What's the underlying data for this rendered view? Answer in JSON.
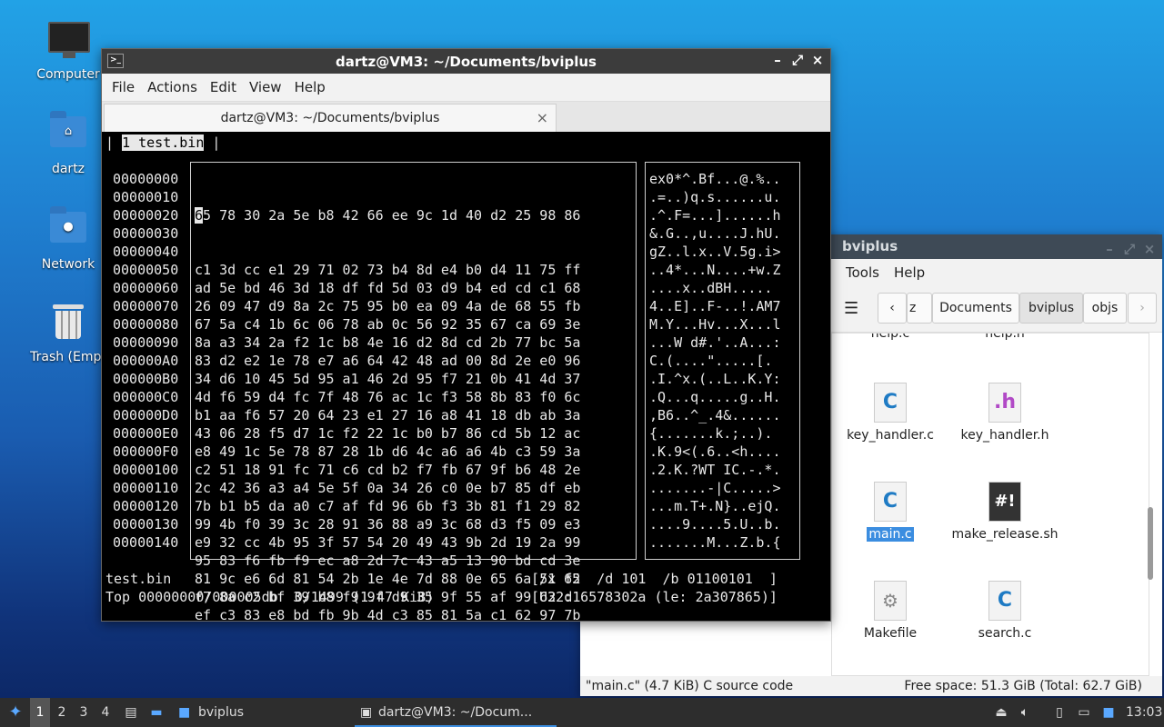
{
  "desktop": {
    "icons": [
      {
        "label": "Computer",
        "icon": "computer-icon"
      },
      {
        "label": "dartz",
        "icon": "home-folder-icon"
      },
      {
        "label": "Network",
        "icon": "network-folder-icon"
      },
      {
        "label": "Trash (Empt",
        "icon": "trash-icon"
      }
    ]
  },
  "terminal": {
    "title": "dartz@VM3: ~/Documents/bviplus",
    "menu": [
      "File",
      "Actions",
      "Edit",
      "View",
      "Help"
    ],
    "tab_label": "dartz@VM3: ~/Documents/bviplus",
    "buffer_tab": "1 test.bin",
    "cursor_char": "6",
    "offsets": [
      "00000000",
      "00000010",
      "00000020",
      "00000030",
      "00000040",
      "00000050",
      "00000060",
      "00000070",
      "00000080",
      "00000090",
      "000000A0",
      "000000B0",
      "000000C0",
      "000000D0",
      "000000E0",
      "000000F0",
      "00000100",
      "00000110",
      "00000120",
      "00000130",
      "00000140"
    ],
    "hex_first_tail": "5 78 30 2a 5e b8 42 66 ee 9c 1d 40 d2 25 98 86",
    "hex_rows": [
      "c1 3d cc e1 29 71 02 73 b4 8d e4 b0 d4 11 75 ff",
      "ad 5e bd 46 3d 18 df fd 5d 03 d9 b4 ed cd c1 68",
      "26 09 47 d9 8a 2c 75 95 b0 ea 09 4a de 68 55 fb",
      "67 5a c4 1b 6c 06 78 ab 0c 56 92 35 67 ca 69 3e",
      "8a a3 34 2a f2 1c b8 4e 16 d2 8d cd 2b 77 bc 5a",
      "83 d2 e2 1e 78 e7 a6 64 42 48 ad 00 8d 2e e0 96",
      "34 d6 10 45 5d 95 a1 46 2d 95 f7 21 0b 41 4d 37",
      "4d f6 59 d4 fc 7f 48 76 ac 1c f3 58 8b 83 f0 6c",
      "b1 aa f6 57 20 64 23 e1 27 16 a8 41 18 db ab 3a",
      "43 06 28 f5 d7 1c f2 22 1c b0 b7 86 cd 5b 12 ac",
      "e8 49 1c 5e 78 87 28 1b d6 4c a6 a6 4b c3 59 3a",
      "c2 51 18 91 fc 71 c6 cd b2 f7 fb 67 9f b6 48 2e",
      "2c 42 36 a3 a4 5e 5f 0a 34 26 c0 0e b7 85 df eb",
      "7b b1 b5 da a0 c7 af fd 96 6b f3 3b 81 f1 29 82",
      "99 4b f0 39 3c 28 91 36 88 a9 3c 68 d3 f5 09 e3",
      "e9 32 cc 4b 95 3f 57 54 20 49 43 9b 2d 19 2a 99",
      "95 83 f6 fb f9 ec a8 2d 7c 43 a5 13 90 bd cd 3e",
      "81 9c e6 6d 81 54 2b 1e 4e 7d 88 0e 65 6a 51 f2",
      "f7 8a c2 bf 39 b8 f9 9f d9 35 9f 55 af 99 62 d1",
      "ef c3 83 e8 bd fb 9b 4d c3 85 81 5a c1 62 97 7b"
    ],
    "ascii_rows": [
      "ex0*^.Bf...@.%..",
      ".=..)q.s......u.",
      ".^.F=...]......h",
      "&.G..,u....J.hU.",
      "gZ..l.x..V.5g.i>",
      "..4*...N....+w.Z",
      "....x..dBH.....",
      "4..E]..F-..!.AM7",
      "M.Y...Hv...X...l",
      "...W d#.'..A...:",
      "C.(....\".....[.",
      ".I.^x.(..L..K.Y:",
      ".Q...q.....g..H.",
      ",B6..^_.4&......",
      "{.......k.;..).",
      ".K.9<(.6..<h....",
      ".2.K.?WT IC.-.*.",
      ".......-|C.....>",
      "...m.T+.N}..ejQ.",
      "....9....5.U..b.",
      ".......M...Z.b.{"
    ],
    "status_file": "test.bin",
    "status_values": "[/x 65  /d 101  /b 01100101  ]",
    "status_pos": "Top 00000000/000005db  0/1499 (1.47 KiB)",
    "status_u32": "[U32: 6578302a (le: 2a307865)]"
  },
  "file_manager": {
    "title": "bviplus",
    "menu": [
      "Tools",
      "Help"
    ],
    "breadcrumbs": [
      "z",
      "Documents",
      "bviplus",
      "objs"
    ],
    "partial_labels": [
      "help.c",
      "help.h"
    ],
    "files": [
      {
        "name": "key_handler.c",
        "type": "C"
      },
      {
        "name": "key_handler.h",
        "type": ".h"
      },
      {
        "name": "main.c",
        "type": "C"
      },
      {
        "name": "make_release.sh",
        "type": "#!"
      },
      {
        "name": "Makefile",
        "type": "⚙"
      },
      {
        "name": "search.c",
        "type": "C"
      }
    ],
    "status_left": "\"main.c\" (4.7 KiB) C source code",
    "status_right": "Free space: 51.3 GiB (Total: 62.7 GiB)"
  },
  "taskbar": {
    "workspaces": [
      "1",
      "2",
      "3",
      "4"
    ],
    "tasks": [
      "bviplus",
      "dartz@VM3: ~/Docum..."
    ],
    "clock": "13:03"
  }
}
